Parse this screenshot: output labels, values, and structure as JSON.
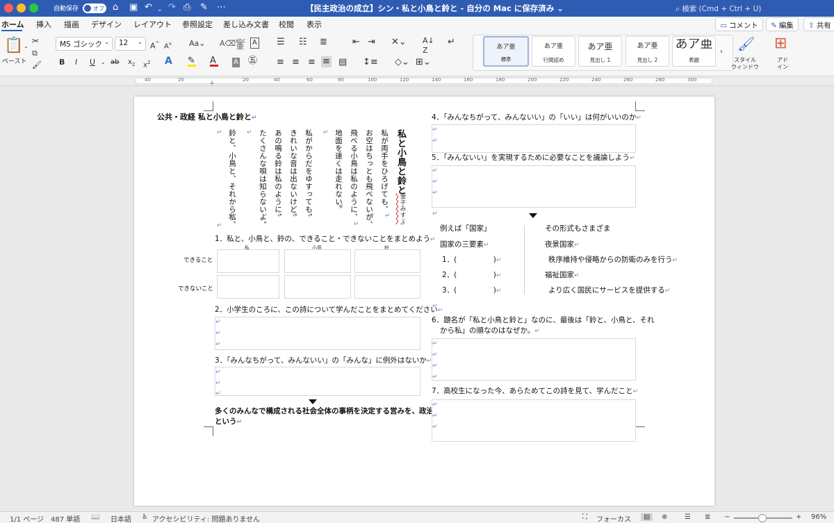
{
  "titlebar": {
    "autosave_label": "自動保存",
    "autosave_state": "オフ",
    "document_title": "【民主政治の成立】シン・私と小鳥と鈴と - 自分の Mac に保存済み ⌄",
    "search_placeholder": "検索 (Cmd + Ctrl + U)"
  },
  "tabs": [
    "ホーム",
    "挿入",
    "描画",
    "デザイン",
    "レイアウト",
    "参照設定",
    "差し込み文書",
    "校閲",
    "表示"
  ],
  "toolbar_buttons": {
    "comments": "コメント",
    "editing": "編集",
    "share": "共有"
  },
  "ribbon": {
    "paste_label": "ペースト",
    "font_name": "MS ゴシック",
    "font_size": "12",
    "styles": [
      {
        "preview": "あア亜",
        "name": "標準"
      },
      {
        "preview": "あア亜",
        "name": "行間詰め"
      },
      {
        "preview": "あア亜",
        "name": "見出し 1"
      },
      {
        "preview": "あア亜",
        "name": "見出し 2"
      },
      {
        "preview": "あア亜",
        "name": "表題"
      }
    ],
    "styles_pane_label": "スタイル\nウィンドウ",
    "addins_label": "アド\nイン"
  },
  "ruler_numbers": [
    "40",
    "20",
    "",
    "20",
    "40",
    "60",
    "80",
    "100",
    "120",
    "140",
    "160",
    "180",
    "200",
    "220",
    "240",
    "260",
    "280",
    "300"
  ],
  "document": {
    "heading": "公共・政経  私と小鳥と鈴と",
    "poem": {
      "title": "私と小鳥と鈴と",
      "author": "金子みすゞ",
      "lines": [
        "私が両手をひろげても、",
        "お空はちっとも飛べないが、",
        "飛べる小鳥は私のように、",
        "地面を速くは走れない。",
        "私がからだをゆすっても、",
        "きれいな音は出ないけど、",
        "あの鳴る鈴は私のように、",
        "たくさんな唄は知らないよ。",
        "鈴と、小鳥と、それから私、"
      ]
    },
    "q1": "1．私と、小鳥と、鈴の、できること・できないことをまとめよう",
    "q1_columns": [
      "私",
      "小鳥",
      "鈴"
    ],
    "q1_rows": [
      "できること",
      "できないこと"
    ],
    "q2": "2．小学生のころに、この詩について学んだことをまとめてください",
    "q3": "3．「みんなちがって、みんないい」の「みんな」に例外はないか",
    "politics_text": [
      "多くのみんなで構成される社会全体の事柄を決定する営みを、政治",
      "という"
    ],
    "q4": "4．「みんなちがって、みんないい」の「いい」は何がいいのか",
    "q5": "5．「みんないい」を実現するために必要なことを議論しよう",
    "state_left": [
      "例えば「国家」",
      "国家の三要素",
      "1．(　　　　　)",
      "2．(　　　　　)",
      "3．(　　　　　)"
    ],
    "state_right": [
      "その形式もさまざま",
      "夜景国家",
      "秩序維持や侵略からの防衛のみを行う",
      "福祉国家",
      "より広く国民にサービスを提供する"
    ],
    "q6": [
      "6．題名が「私と小鳥と鈴と」なのに、最後は「鈴と、小鳥と、それ",
      "から私」の順なのはなぜか。"
    ],
    "q7": "7．高校生になった今、あらためてこの詩を見て、学んだこと"
  },
  "statusbar": {
    "page": "1/1 ページ",
    "words": "487 単語",
    "language": "日本語",
    "accessibility": "アクセシビリティ: 問題ありません",
    "focus": "フォーカス",
    "zoom": "96%"
  }
}
